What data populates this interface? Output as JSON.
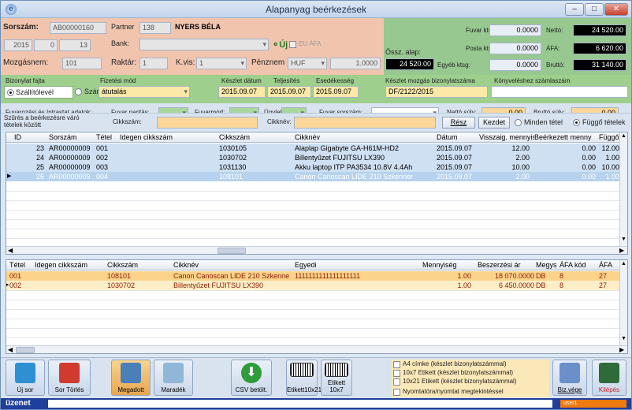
{
  "window": {
    "title": "Alapanyag beérkezések"
  },
  "header": {
    "sorszam_label": "Sorszám:",
    "sorszam_value": "AB00000160",
    "partner_label": "Partner",
    "partner_code": "138",
    "partner_name": "NYERS BÉLA",
    "year": "2015",
    "f1": "0",
    "f2": "13",
    "bank_label": "Bank:",
    "uj_label": "Új",
    "eu_afa_label": "EU ÁFA",
    "mozgasnem_label": "Mozgásnem:",
    "mozgasnem_value": "101",
    "raktar_label": "Raktár:",
    "raktar_value": "1",
    "kvis_label": "K.vis:",
    "kvis_value": "1",
    "penznem_label": "Pénznem",
    "penznem_value": "HUF",
    "arfolyam": "1.0000"
  },
  "totals": {
    "ossz_alap_label": "Össz. alap:",
    "ossz_alap": "24 520.00",
    "fuvar_label": "Fuvar ktsg:",
    "fuvar": "0.0000",
    "posta_label": "Posta ktsg:",
    "posta": "0.0000",
    "egyeb_label": "Egyéb ktsg:",
    "egyeb": "0.0000",
    "netto_label": "Nettó:",
    "netto": "24 520.00",
    "afa_label": "ÁFA:",
    "afa": "6 620.00",
    "brutto_label": "Bruttó:",
    "brutto": "31 140.00"
  },
  "docinfo": {
    "bizonylat_fajta_label": "Bizonylat fajta",
    "szallitolevel": "Szállítólevél",
    "szamla": "Számla",
    "fizetesi_mod_label": "Fizetési mód",
    "fizetesi_mod": "átutalás",
    "keszlet_datum_label": "Készlet dátum",
    "keszlet_datum": "2015.09.07",
    "teljesites_label": "Teljesítés",
    "teljesites": "2015.09.07",
    "esedekesseg_label": "Esedékesség",
    "esedekesseg": "2015.09.07",
    "keszlet_mozgas_label": "Készlet mozgás bizonylatszáma",
    "keszlet_mozgas": "DF/2122/2015",
    "konyveleshez_label": "Könyveléshez számlaszám"
  },
  "freight": {
    "title": "Fuvarozási és Intrastat adatok:",
    "fuvar_paritas": "Fuvar paritás:",
    "fuvarmod": "Fuvarmód:",
    "ugylet": "Ügylet:",
    "fuvar_sorszam": "Fuvar sorszám:",
    "netto_suly": "Nettó súly:",
    "netto_suly_value": "0.00",
    "brutto_suly": "Bruttó súly:",
    "brutto_suly_value": "0.00"
  },
  "filter": {
    "title": "Szűrés a beérkezésre váró tételek között",
    "cikkszam_label": "Cikkszám:",
    "cikknev_label": "Cikknév:",
    "resz_button": "Rész",
    "kezdet_button": "Kezdet",
    "minden": "Minden tétel",
    "fuggo": "Függő tételek"
  },
  "upper_grid": {
    "columns": [
      "ID",
      "Sorszám",
      "Tétel",
      "Idegen cikkszám",
      "Cikkszám",
      "Cikknév",
      "Dátum",
      "Visszaig. mennyis",
      "Beérkezett menny",
      "Függő"
    ],
    "rows": [
      [
        "23",
        "AR00000009",
        "001",
        "",
        "1030105",
        "Alaplap Gigabyte GA-H61M-HD2",
        "2015.09.07",
        "12.00",
        "0.00",
        "12.00"
      ],
      [
        "24",
        "AR00000009",
        "002",
        "",
        "1030702",
        "Billentyűzet FUJITSU LX390",
        "2015.09.07",
        "2.00",
        "0.00",
        "1.00"
      ],
      [
        "25",
        "AR00000009",
        "003",
        "",
        "1031130",
        "Akku laptop ITP PA3534 10.8V 4.4Ah",
        "2015.09.07",
        "10.00",
        "0.00",
        "10.00"
      ],
      [
        "26",
        "AR00000009",
        "004",
        "",
        "108101",
        "Canon Canoscan LIDE 210 Szkenner",
        "2015.09.07",
        "2.00",
        "0.00",
        "1.00"
      ]
    ]
  },
  "lower_grid": {
    "columns": [
      "Tétel",
      "Idegen cikkszám",
      "Cikkszám",
      "Cikknév",
      "Egyedi",
      "Mennyiség",
      "Beszerzési ár",
      "Megys",
      "ÁFA kód",
      "ÁFA"
    ],
    "rows": [
      [
        "001",
        "",
        "108101",
        "Canon Canoscan LIDE 210 Szkenne",
        "1111111111111111111",
        "1.00",
        "18 070.0000",
        "DB",
        "8",
        "27"
      ],
      [
        "002",
        "",
        "1030702",
        "Billentyűzet FUJITSU LX390",
        "",
        "1.00",
        "6 450.0000",
        "DB",
        "8",
        "27"
      ]
    ]
  },
  "toolbar": {
    "uj_sor": "Új sor",
    "sor_torles": "Sor Törlés",
    "megadott": "Megadott",
    "maradek": "Maradék",
    "csv": "CSV betölt.",
    "etikett10x21": "Etikett10x21",
    "etikett10x7": "Etikett 10x7",
    "opt1": "A4 címke (készlet bizonylatszámmal)",
    "opt2": "10x7 Etikett (készlet bizonylatszámmal)",
    "opt3": "10x21 Etikett (készlet bizonylatszámmal)",
    "opt4": "Nyomtatóra/nyomtat megtekintéssel",
    "biz_vege": "Biz.vége",
    "kilepes": "Kilépés"
  },
  "status": {
    "message": "üzenet",
    "user": "user1"
  }
}
